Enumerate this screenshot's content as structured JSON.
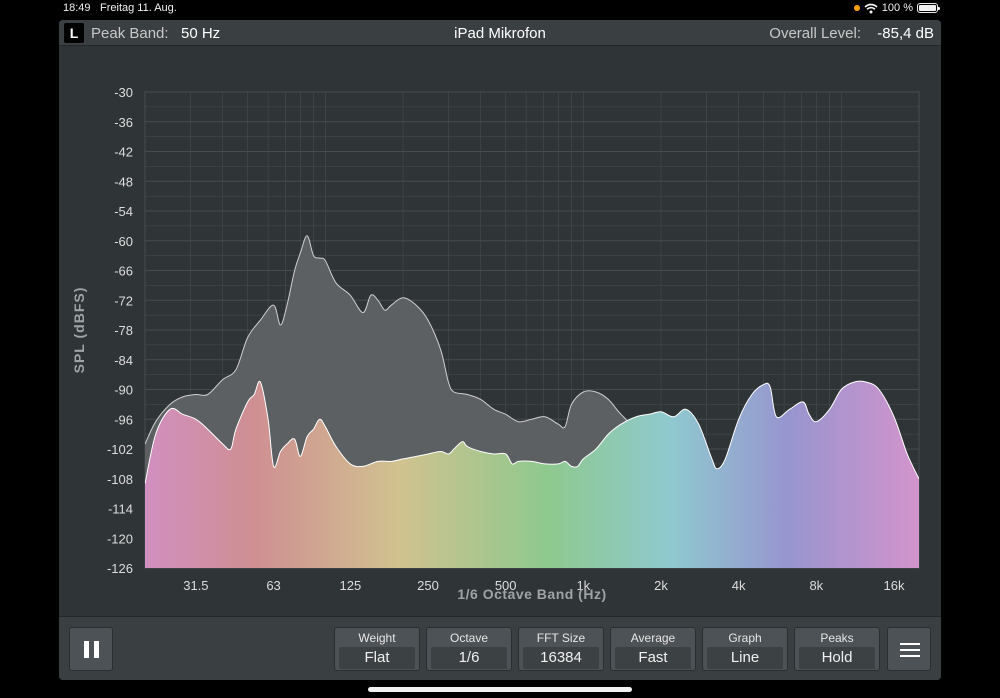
{
  "status": {
    "time": "18:49",
    "date": "Freitag 11. Aug.",
    "battery": "100 %",
    "wifi_icon": "wifi-icon"
  },
  "header": {
    "channel": "L",
    "peak_label": "Peak Band:",
    "peak_value": "50 Hz",
    "title": "iPad Mikrofon",
    "overall_label": "Overall Level:",
    "overall_value": "-85,4 dB"
  },
  "chart_data": {
    "type": "area",
    "xlabel": "1/6 Octave Band (Hz)",
    "ylabel": "SPL (dBFS)",
    "ylim": [
      -126,
      -30
    ],
    "x_scale": "log",
    "xlim": [
      20,
      20000
    ],
    "x_ticks": [
      {
        "value": 31.5,
        "label": "31.5"
      },
      {
        "value": 63,
        "label": "63"
      },
      {
        "value": 125,
        "label": "125"
      },
      {
        "value": 250,
        "label": "250"
      },
      {
        "value": 500,
        "label": "500"
      },
      {
        "value": 1000,
        "label": "1k"
      },
      {
        "value": 2000,
        "label": "2k"
      },
      {
        "value": 4000,
        "label": "4k"
      },
      {
        "value": 8000,
        "label": "8k"
      },
      {
        "value": 16000,
        "label": "16k"
      }
    ],
    "y_ticks": [
      -30,
      -36,
      -42,
      -48,
      -54,
      -60,
      -66,
      -72,
      -78,
      -84,
      -90,
      -96,
      -102,
      -108,
      -114,
      -120,
      -126
    ],
    "grid": true,
    "colors": {
      "background": "#2f3437",
      "grid": "#464c50",
      "peak_fill": "#5c6062",
      "peak_line": "#cfcfcf",
      "spectrum": [
        "#d18fc0",
        "#cf8f92",
        "#d0c28f",
        "#8ec98e",
        "#8fc9cf",
        "#9795cf",
        "#d394cc"
      ]
    },
    "series": [
      {
        "points": [
          [
            20,
            -101
          ],
          [
            22,
            -96.5
          ],
          [
            25,
            -93
          ],
          [
            28,
            -91.5
          ],
          [
            31.5,
            -91
          ],
          [
            35,
            -91
          ],
          [
            40,
            -88
          ],
          [
            45,
            -86
          ],
          [
            50,
            -79.5
          ],
          [
            56,
            -76
          ],
          [
            63,
            -73
          ],
          [
            67,
            -77
          ],
          [
            71,
            -73
          ],
          [
            76,
            -66
          ],
          [
            80,
            -62.5
          ],
          [
            85,
            -59
          ],
          [
            90,
            -63
          ],
          [
            95,
            -63.5
          ],
          [
            100,
            -64
          ],
          [
            110,
            -68.5
          ],
          [
            125,
            -71
          ],
          [
            140,
            -74.5
          ],
          [
            150,
            -71
          ],
          [
            160,
            -72
          ],
          [
            170,
            -74
          ],
          [
            180,
            -73
          ],
          [
            200,
            -71.5
          ],
          [
            225,
            -73
          ],
          [
            250,
            -76
          ],
          [
            280,
            -82
          ],
          [
            300,
            -88.5
          ],
          [
            315,
            -90.5
          ],
          [
            355,
            -91
          ],
          [
            400,
            -92
          ],
          [
            450,
            -94
          ],
          [
            500,
            -95
          ],
          [
            560,
            -96.5
          ],
          [
            630,
            -96
          ],
          [
            710,
            -95.5
          ],
          [
            800,
            -97
          ],
          [
            850,
            -97.5
          ],
          [
            900,
            -93
          ],
          [
            1000,
            -90.5
          ],
          [
            1120,
            -90.5
          ],
          [
            1250,
            -92
          ],
          [
            1400,
            -95
          ],
          [
            1600,
            -97.5
          ],
          [
            1800,
            -96
          ],
          [
            2000,
            -95.2
          ],
          [
            2240,
            -95.5
          ]
        ]
      },
      {
        "points": [
          [
            20,
            -109
          ],
          [
            22,
            -99
          ],
          [
            25,
            -94
          ],
          [
            28,
            -95
          ],
          [
            31.5,
            -96
          ],
          [
            35,
            -98
          ],
          [
            40,
            -101
          ],
          [
            43,
            -102
          ],
          [
            45,
            -98
          ],
          [
            50,
            -92.5
          ],
          [
            53,
            -91
          ],
          [
            56,
            -88.5
          ],
          [
            60,
            -96
          ],
          [
            63,
            -105.5
          ],
          [
            67,
            -102.5
          ],
          [
            71,
            -101
          ],
          [
            76,
            -100
          ],
          [
            80,
            -103.5
          ],
          [
            85,
            -99.5
          ],
          [
            90,
            -98
          ],
          [
            95,
            -96
          ],
          [
            100,
            -97.5
          ],
          [
            110,
            -101.5
          ],
          [
            125,
            -105
          ],
          [
            140,
            -105.5
          ],
          [
            160,
            -104.5
          ],
          [
            180,
            -104.5
          ],
          [
            200,
            -104
          ],
          [
            225,
            -103.5
          ],
          [
            250,
            -103
          ],
          [
            280,
            -102.5
          ],
          [
            300,
            -103
          ],
          [
            315,
            -102
          ],
          [
            340,
            -100.5
          ],
          [
            355,
            -101.5
          ],
          [
            400,
            -102.5
          ],
          [
            450,
            -103
          ],
          [
            500,
            -103
          ],
          [
            530,
            -105
          ],
          [
            560,
            -104.5
          ],
          [
            630,
            -104.5
          ],
          [
            710,
            -105
          ],
          [
            800,
            -105
          ],
          [
            850,
            -104.5
          ],
          [
            900,
            -105.5
          ],
          [
            950,
            -105.5
          ],
          [
            1000,
            -104
          ],
          [
            1120,
            -102
          ],
          [
            1250,
            -99
          ],
          [
            1400,
            -97
          ],
          [
            1600,
            -95.5
          ],
          [
            1800,
            -95
          ],
          [
            2000,
            -94.5
          ],
          [
            2240,
            -95.5
          ],
          [
            2500,
            -94
          ],
          [
            2800,
            -97
          ],
          [
            3150,
            -104
          ],
          [
            3300,
            -106
          ],
          [
            3550,
            -104
          ],
          [
            4000,
            -96
          ],
          [
            4500,
            -91
          ],
          [
            5000,
            -89
          ],
          [
            5300,
            -89.5
          ],
          [
            5600,
            -95.5
          ],
          [
            6300,
            -94
          ],
          [
            7100,
            -92.5
          ],
          [
            7500,
            -95
          ],
          [
            8000,
            -96.5
          ],
          [
            9000,
            -94
          ],
          [
            10000,
            -90
          ],
          [
            11200,
            -88.5
          ],
          [
            12500,
            -88.5
          ],
          [
            14000,
            -90
          ],
          [
            16000,
            -95.5
          ],
          [
            18000,
            -103
          ],
          [
            20000,
            -108
          ]
        ]
      }
    ]
  },
  "toolbar": {
    "pause_icon": "pause-icon",
    "menu_icon": "hamburger-menu-icon",
    "controls": [
      {
        "label": "Weight",
        "value": "Flat"
      },
      {
        "label": "Octave",
        "value": "1/6"
      },
      {
        "label": "FFT Size",
        "value": "16384"
      },
      {
        "label": "Average",
        "value": "Fast"
      },
      {
        "label": "Graph",
        "value": "Line"
      },
      {
        "label": "Peaks",
        "value": "Hold"
      }
    ]
  }
}
